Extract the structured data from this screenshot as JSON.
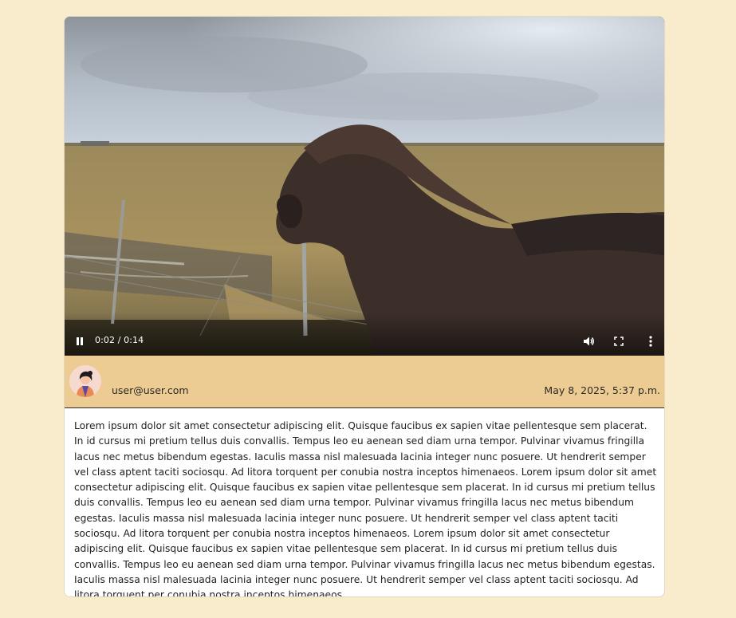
{
  "video": {
    "time_display": "0:02 / 0:14",
    "progress_fraction": 0.139,
    "state": "playing",
    "icons": {
      "play_toggle": "pause-icon",
      "volume": "volume-icon",
      "fullscreen": "fullscreen-icon",
      "more": "more-vertical-icon"
    }
  },
  "post": {
    "author_email": "user@user.com",
    "date": "May 8, 2025, 5:37 p.m.",
    "avatar_icon": "avatar",
    "body": "Lorem ipsum dolor sit amet consectetur adipiscing elit. Quisque faucibus ex sapien vitae pellentesque sem placerat. In id cursus mi pretium tellus duis convallis. Tempus leo eu aenean sed diam urna tempor. Pulvinar vivamus fringilla lacus nec metus bibendum egestas. Iaculis massa nisl malesuada lacinia integer nunc posuere. Ut hendrerit semper vel class aptent taciti sociosqu. Ad litora torquent per conubia nostra inceptos himenaeos. Lorem ipsum dolor sit amet consectetur adipiscing elit. Quisque faucibus ex sapien vitae pellentesque sem placerat. In id cursus mi pretium tellus duis convallis. Tempus leo eu aenean sed diam urna tempor. Pulvinar vivamus fringilla lacus nec metus bibendum egestas. Iaculis massa nisl malesuada lacinia integer nunc posuere. Ut hendrerit semper vel class aptent taciti sociosqu. Ad litora torquent per conubia nostra inceptos himenaeos. Lorem ipsum dolor sit amet consectetur adipiscing elit. Quisque faucibus ex sapien vitae pellentesque sem placerat. In id cursus mi pretium tellus duis convallis. Tempus leo eu aenean sed diam urna tempor. Pulvinar vivamus fringilla lacus nec metus bibendum egestas. Iaculis massa nisl malesuada lacinia integer nunc posuere. Ut hendrerit semper vel class aptent taciti sociosqu. Ad litora torquent per conubia nostra inceptos himenaeos."
  },
  "colors": {
    "page_background": "#f9eccd",
    "meta_bar": "#edcc93",
    "card": "#ffffff"
  }
}
